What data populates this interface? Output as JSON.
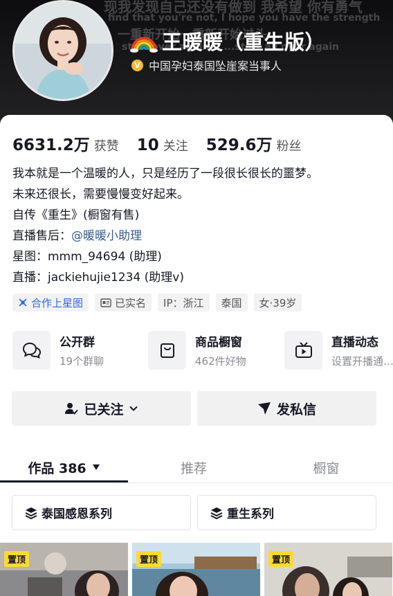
{
  "banner": {
    "lines": [
      "现我发现自己还没有做到 我希望 你有勇气",
      "find that you're not, I hope you have the strength",
      "一重新开始一重新开始过头",
      "start over again... ...start all over again"
    ]
  },
  "profile": {
    "nickname": "王暖暖（重生版）",
    "verification": "中国孕妇泰国坠崖案当事人",
    "verify_icon": "verified-v-icon"
  },
  "stats": [
    {
      "num": "6631.2万",
      "label": "获赞"
    },
    {
      "num": "10",
      "label": "关注"
    },
    {
      "num": "529.6万",
      "label": "粉丝"
    }
  ],
  "bio": {
    "line1": "我本就是一个温暖的人，只是经历了一段很长很长的噩梦。",
    "line2": "未来还很长，需要慢慢变好起来。",
    "line3": "自传《重生》(橱窗有售)",
    "line4_prefix": "直播售后：",
    "line4_link": "@暖暖小助理",
    "line5": "星图：mmm_94694 (助理)",
    "line6": "直播：jackiehujie1234 (助理v)"
  },
  "tags": [
    {
      "label": "合作上星图",
      "icon": "star-chart-icon"
    },
    {
      "label": "已实名",
      "icon": "id-card-icon"
    },
    {
      "label": "IP：浙江"
    },
    {
      "label": "泰国"
    },
    {
      "label": "女·39岁"
    }
  ],
  "entries": [
    {
      "title": "公开群",
      "sub": "19个群聊",
      "icon": "group-chat-icon"
    },
    {
      "title": "商品橱窗",
      "sub": "462件好物",
      "icon": "shopping-bag-icon"
    },
    {
      "title": "直播动态",
      "sub": "设置开播通…",
      "icon": "tv-play-icon"
    }
  ],
  "actions": {
    "follow": "已关注",
    "message": "发私信"
  },
  "tabs": {
    "works": "作品 386",
    "recommend": "推荐",
    "showcase": "橱窗"
  },
  "collections": [
    {
      "label": "泰国感恩系列"
    },
    {
      "label": "重生系列"
    }
  ],
  "videos": [
    {
      "badge": "置顶"
    },
    {
      "badge": "置顶"
    },
    {
      "badge": "置顶"
    }
  ],
  "colors": {
    "link": "#3a5b8c",
    "tag_blue": "#2d6bd8",
    "badge": "#fdd835",
    "verify": "#f4b93a"
  }
}
